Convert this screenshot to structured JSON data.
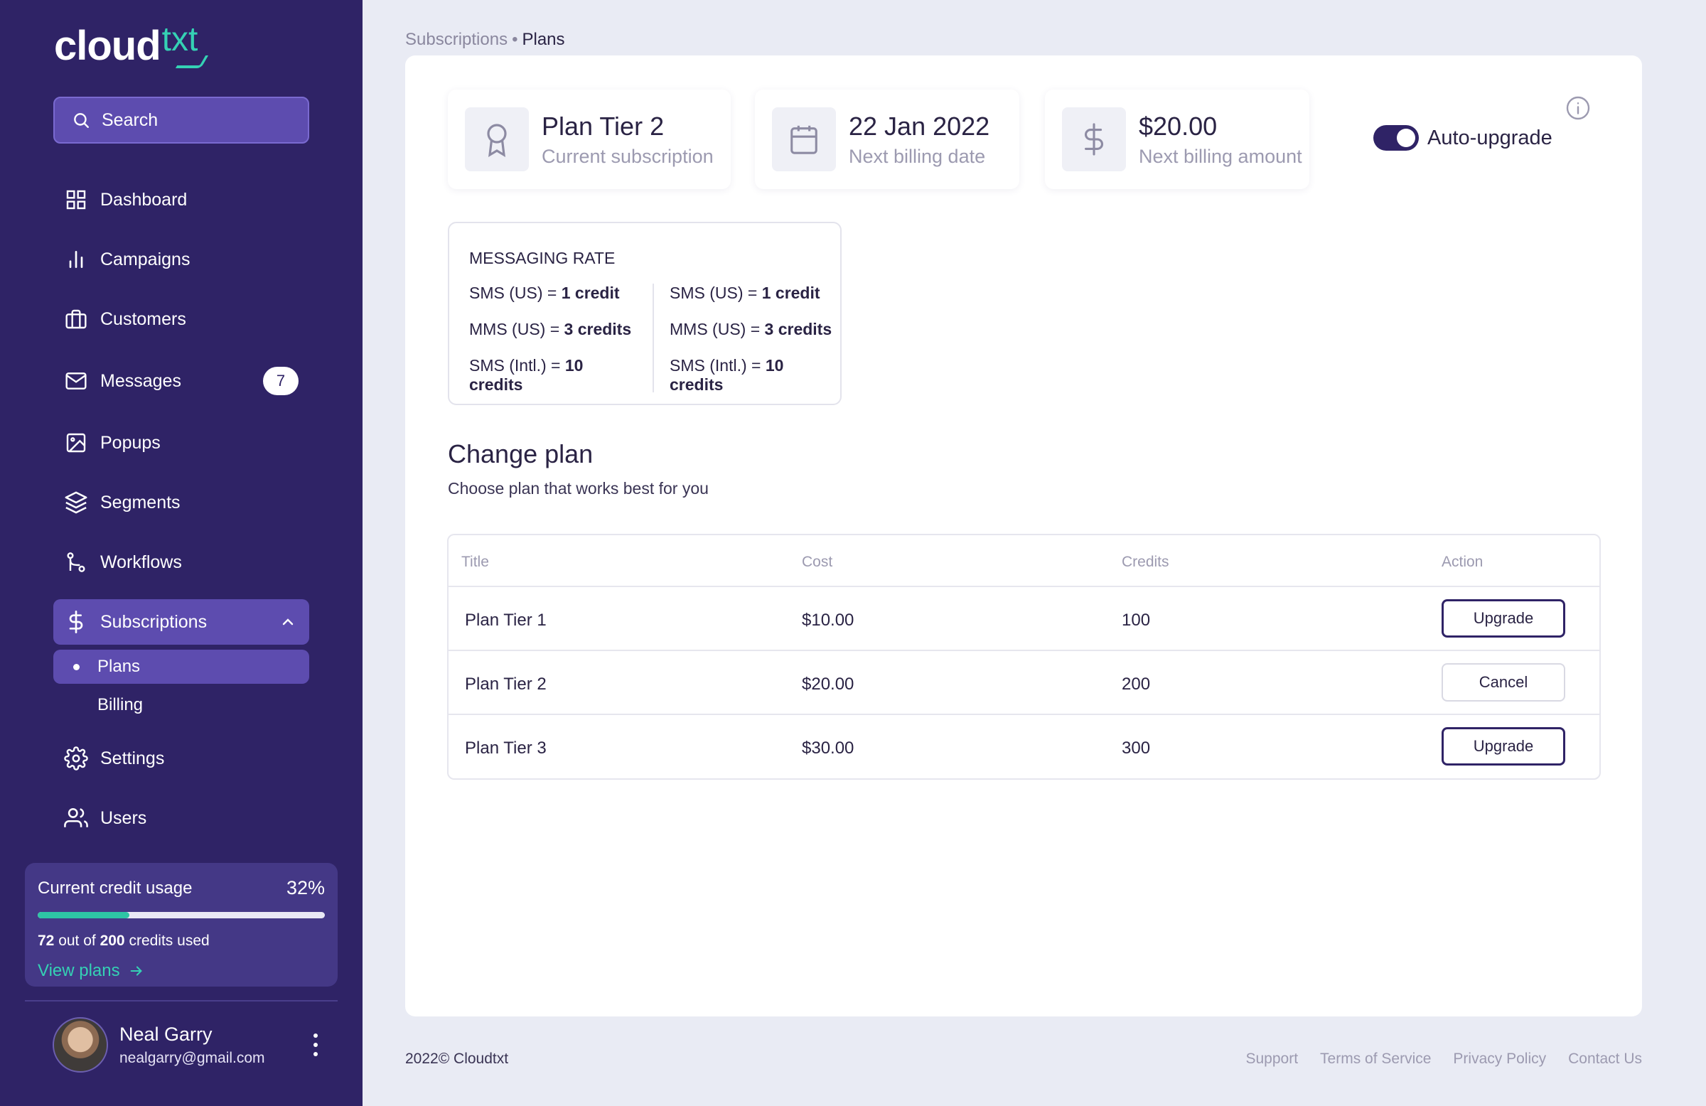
{
  "brand": {
    "name_main": "cloud",
    "name_accent": "txt",
    "accent_color": "#35d1b4",
    "sidebar_color": "#2f2366"
  },
  "sidebar": {
    "search_label": "Search",
    "items": [
      {
        "label": "Dashboard",
        "icon": "grid-icon"
      },
      {
        "label": "Campaigns",
        "icon": "bar-chart-icon"
      },
      {
        "label": "Customers",
        "icon": "briefcase-icon"
      },
      {
        "label": "Messages",
        "icon": "mail-icon",
        "badge": "7"
      },
      {
        "label": "Popups",
        "icon": "image-icon"
      },
      {
        "label": "Segments",
        "icon": "layers-icon"
      },
      {
        "label": "Workflows",
        "icon": "git-branch-icon"
      },
      {
        "label": "Subscriptions",
        "icon": "dollar-icon",
        "expanded": true
      },
      {
        "label": "Settings",
        "icon": "gear-icon"
      },
      {
        "label": "Users",
        "icon": "users-icon"
      }
    ],
    "subitems": [
      {
        "label": "Plans",
        "active": true
      },
      {
        "label": "Billing",
        "active": false
      }
    ]
  },
  "credit_usage": {
    "title": "Current credit usage",
    "percent_label": "32%",
    "percent": 32,
    "used_prefix": "72",
    "used_middle": " out of ",
    "used_total": "200",
    "used_suffix": " credits used",
    "view_plans": "View plans"
  },
  "profile": {
    "name": "Neal Garry",
    "email": "nealgarry@gmail.com"
  },
  "breadcrumb": {
    "parent": "Subscriptions",
    "separator": "•",
    "current": "Plans"
  },
  "stats": {
    "subscription": {
      "value": "Plan Tier 2",
      "label": "Current subscription"
    },
    "billing_date": {
      "value": "22 Jan 2022",
      "label": "Next billing date"
    },
    "billing_amount": {
      "value": "$20.00",
      "label": "Next billing amount"
    }
  },
  "auto_upgrade": {
    "label": "Auto-upgrade",
    "enabled": true
  },
  "messaging_rate": {
    "title": "MESSAGING RATE",
    "left": [
      {
        "prefix": "SMS (US) = ",
        "value": "1 credit"
      },
      {
        "prefix": "MMS (US) = ",
        "value": "3 credits"
      },
      {
        "prefix": "SMS (Intl.) = ",
        "value": "10 credits"
      }
    ],
    "right": [
      {
        "prefix": "SMS (US) = ",
        "value": "1 credit"
      },
      {
        "prefix": "MMS (US) = ",
        "value": "3 credits"
      },
      {
        "prefix": "SMS (Intl.) = ",
        "value": "10 credits"
      }
    ]
  },
  "change_plan": {
    "title": "Change plan",
    "subtitle": "Choose plan that works best for you",
    "columns": [
      "Title",
      "Cost",
      "Credits",
      "Action"
    ],
    "rows": [
      {
        "title": "Plan Tier 1",
        "cost": "$10.00",
        "credits": "100",
        "action": "Upgrade"
      },
      {
        "title": "Plan Tier 2",
        "cost": "$20.00",
        "credits": "200",
        "action": "Cancel"
      },
      {
        "title": "Plan Tier 3",
        "cost": "$30.00",
        "credits": "300",
        "action": "Upgrade"
      }
    ]
  },
  "footer": {
    "copyright": "2022© Cloudtxt",
    "links": [
      "Support",
      "Terms of Service",
      "Privacy Policy",
      "Contact Us"
    ]
  }
}
